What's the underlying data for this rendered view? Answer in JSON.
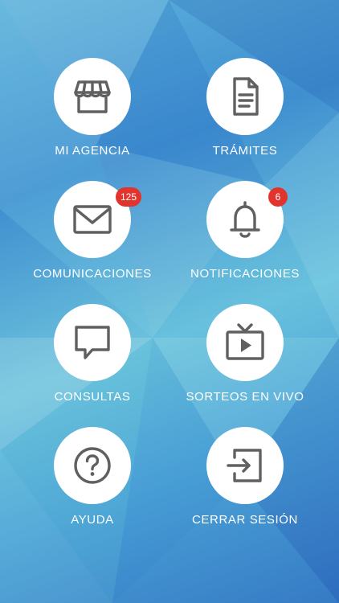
{
  "menu": {
    "items": [
      {
        "label": "MI AGENCIA",
        "icon": "store-icon"
      },
      {
        "label": "TRÁMITES",
        "icon": "document-icon"
      },
      {
        "label": "COMUNICACIONES",
        "icon": "envelope-icon",
        "badge": "125"
      },
      {
        "label": "NOTIFICACIONES",
        "icon": "bell-icon",
        "badge": "6"
      },
      {
        "label": "CONSULTAS",
        "icon": "chat-bubble-icon"
      },
      {
        "label": "SORTEOS EN VIVO",
        "icon": "tv-play-icon"
      },
      {
        "label": "AYUDA",
        "icon": "help-circle-icon"
      },
      {
        "label": "CERRAR SESIÓN",
        "icon": "logout-icon"
      }
    ]
  },
  "colors": {
    "icon": "#606060",
    "badge": "#e2342c",
    "label": "#ffffff"
  }
}
